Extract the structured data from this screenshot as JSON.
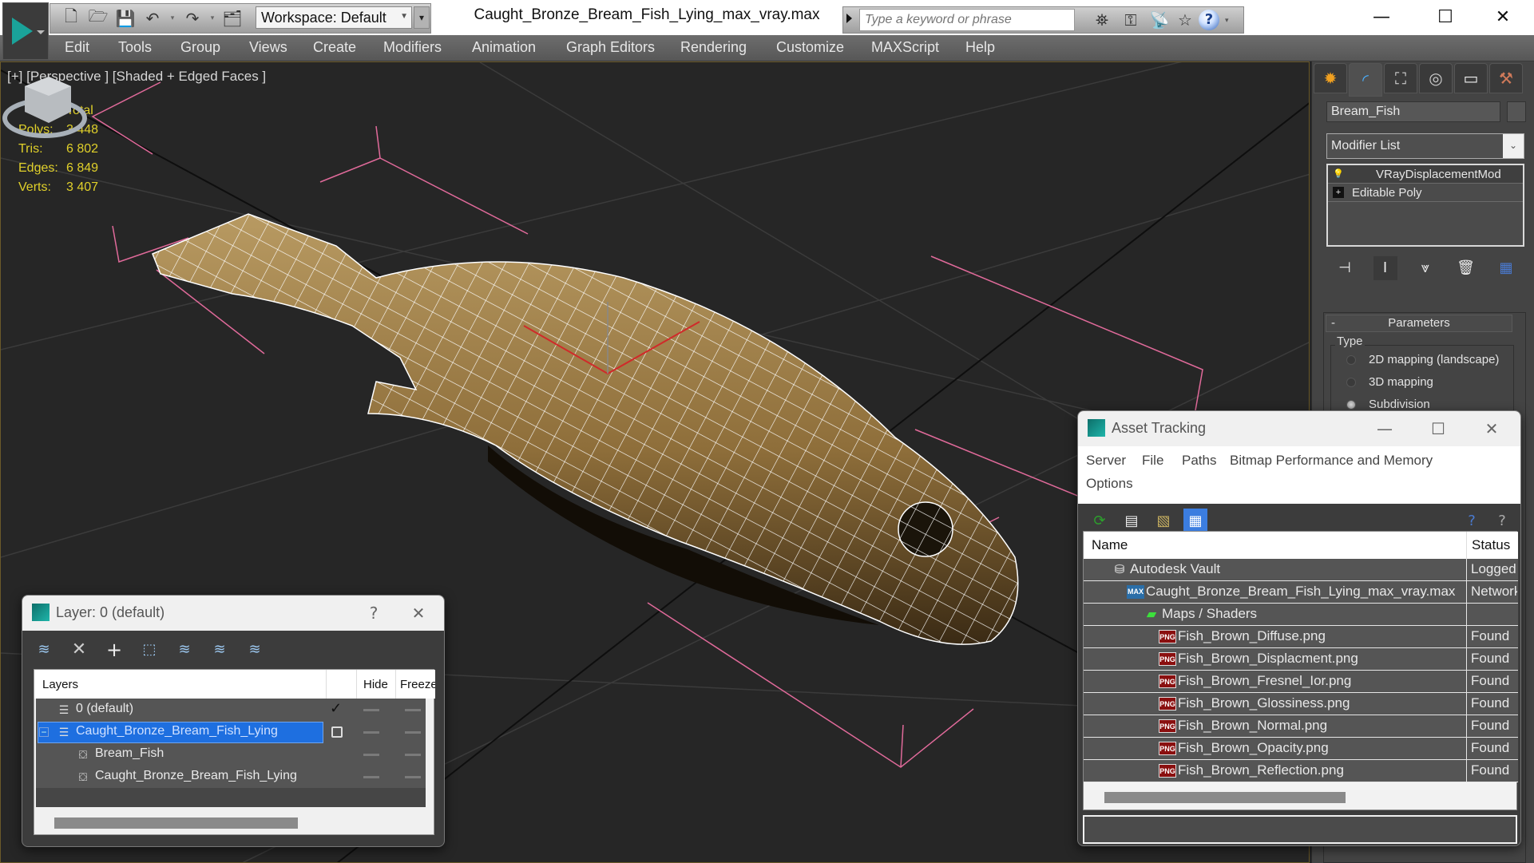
{
  "app": {
    "window_title": "Caught_Bronze_Bream_Fish_Lying_max_vray.max",
    "workspace": "Workspace: Default",
    "search_placeholder": "Type a keyword or phrase",
    "quick_access_icons": [
      "new-file-icon",
      "open-file-icon",
      "save-icon",
      "undo-icon",
      "redo-icon",
      "project-folder-icon"
    ],
    "search_tools": [
      "binoculars-icon",
      "key-icon",
      "satellite-icon",
      "star-icon",
      "help-icon"
    ],
    "window_controls": {
      "minimize": "—",
      "maximize": "☐",
      "close": "✕"
    }
  },
  "menu": [
    "Edit",
    "Tools",
    "Group",
    "Views",
    "Create",
    "Modifiers",
    "Animation",
    "Graph Editors",
    "Rendering",
    "Customize",
    "MAXScript",
    "Help"
  ],
  "viewport": {
    "label": "[+] [Perspective ] [Shaded + Edged Faces ]",
    "stats": {
      "header": "Total",
      "rows": [
        {
          "label": "Polys:",
          "value": "3 448"
        },
        {
          "label": "Tris:",
          "value": "6 802"
        },
        {
          "label": "Edges:",
          "value": "6 849"
        },
        {
          "label": "Verts:",
          "value": "3 407"
        }
      ]
    }
  },
  "command_panel": {
    "tabs": [
      "create-tab",
      "modify-tab",
      "hierarchy-tab",
      "motion-tab",
      "display-tab",
      "utilities-tab"
    ],
    "object_name": "Bream_Fish",
    "modifier_list": "Modifier List",
    "modifier_stack": [
      {
        "label": "VRayDisplacementMod",
        "selected": true
      },
      {
        "label": "Editable Poly",
        "selected": false
      }
    ],
    "parameters_title": "Parameters",
    "collapse_symbol": "-",
    "type_group": "Type",
    "type_options": [
      {
        "label": "2D mapping (landscape)",
        "checked": false
      },
      {
        "label": "3D mapping",
        "checked": false
      },
      {
        "label": "Subdivision",
        "checked": true
      }
    ]
  },
  "layer_dialog": {
    "title": "Layer: 0 (default)",
    "help": "?",
    "close": "✕",
    "columns": [
      "Layers",
      "Hide",
      "Freeze"
    ],
    "rows": [
      {
        "name": "0 (default)",
        "type": "layer",
        "active": true,
        "selected": false,
        "indent": 0
      },
      {
        "name": "Caught_Bronze_Bream_Fish_Lying",
        "type": "layer",
        "active": false,
        "selected": true,
        "indent": 0,
        "expanded": true
      },
      {
        "name": "Bream_Fish",
        "type": "object",
        "indent": 1
      },
      {
        "name": "Caught_Bronze_Bream_Fish_Lying",
        "type": "object",
        "indent": 1
      }
    ]
  },
  "asset_dialog": {
    "title": "Asset Tracking",
    "menu": [
      "Server",
      "File",
      "Paths",
      "Bitmap Performance and Memory",
      "Options"
    ],
    "columns": [
      "Name",
      "Status"
    ],
    "rows": [
      {
        "name": "Autodesk Vault",
        "status": "Logged",
        "icon": "vault",
        "indent": 1
      },
      {
        "name": "Caught_Bronze_Bream_Fish_Lying_max_vray.max",
        "status": "Network",
        "icon": "max",
        "indent": 2
      },
      {
        "name": "Maps / Shaders",
        "status": "",
        "icon": "maps",
        "indent": 3
      },
      {
        "name": "Fish_Brown_Diffuse.png",
        "status": "Found",
        "icon": "png",
        "indent": 4
      },
      {
        "name": "Fish_Brown_Displacment.png",
        "status": "Found",
        "icon": "png",
        "indent": 4
      },
      {
        "name": "Fish_Brown_Fresnel_Ior.png",
        "status": "Found",
        "icon": "png",
        "indent": 4
      },
      {
        "name": "Fish_Brown_Glossiness.png",
        "status": "Found",
        "icon": "png",
        "indent": 4
      },
      {
        "name": "Fish_Brown_Normal.png",
        "status": "Found",
        "icon": "png",
        "indent": 4
      },
      {
        "name": "Fish_Brown_Opacity.png",
        "status": "Found",
        "icon": "png",
        "indent": 4
      },
      {
        "name": "Fish_Brown_Reflection.png",
        "status": "Found",
        "icon": "png",
        "indent": 4
      }
    ]
  },
  "colors": {
    "accent_teal": "#1aa39a",
    "stats_yellow": "#e0d02a",
    "selection_blue": "#1e6fe0",
    "bounding_box_pink": "#e06a9a",
    "fish_brown": "#9b7a45"
  }
}
